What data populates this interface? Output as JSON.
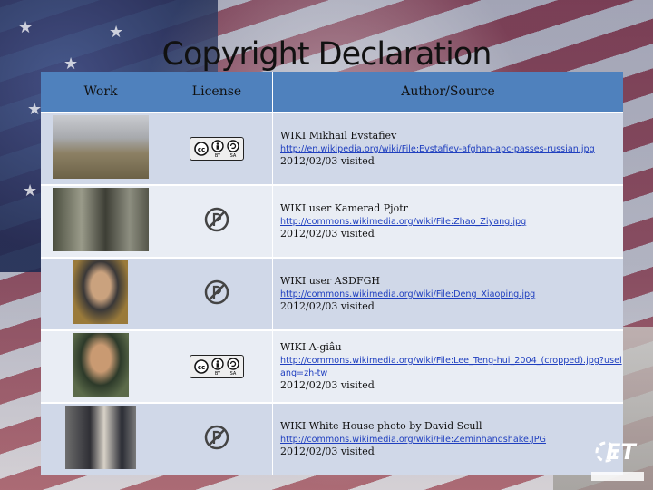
{
  "title": "Copyright Declaration",
  "headers": {
    "work": "Work",
    "license": "License",
    "source": "Author/Source"
  },
  "rows": [
    {
      "photo": "afghan-apc-photo",
      "license": "cc-by-sa",
      "author": "WIKI  Mikhail Evstafiev",
      "url": "http://en.wikipedia.org/wiki/File:Evstafiev-afghan-apc-passes-russian.jpg",
      "visited": "2012/02/03 visited"
    },
    {
      "photo": "zhao-ziyang-photo",
      "license": "public-domain",
      "author": "WIKI user Kamerad Pjotr",
      "url": "http://commons.wikimedia.org/wiki/File:Zhao_Ziyang.jpg",
      "visited": "2012/02/03 visited"
    },
    {
      "photo": "deng-xiaoping-photo",
      "license": "public-domain",
      "author": "WIKI user ASDFGH",
      "url": "http://commons.wikimedia.org/wiki/File:Deng_Xiaoping.jpg",
      "visited": "2012/02/03 visited"
    },
    {
      "photo": "lee-teng-hui-photo",
      "license": "cc-by-sa",
      "author": "WIKI A-giâu",
      "url": "http://commons.wikimedia.org/wiki/File:Lee_Teng-hui_2004_(cropped).jpg?uselang=zh-tw",
      "visited": "2012/02/03 visited"
    },
    {
      "photo": "zemin-handshake-photo",
      "license": "public-domain",
      "author": "WIKI White House photo by David Scull",
      "url": "http://commons.wikimedia.org/wiki/File:Zeminhandshake.JPG",
      "visited": "2012/02/03 visited"
    }
  ],
  "cc": {
    "by": "BY",
    "sa": "SA"
  },
  "colors": {
    "header": "#4f81bd",
    "row_odd": "#d0d8e8",
    "row_even": "#e9edf4",
    "link": "#1f3fbf"
  }
}
